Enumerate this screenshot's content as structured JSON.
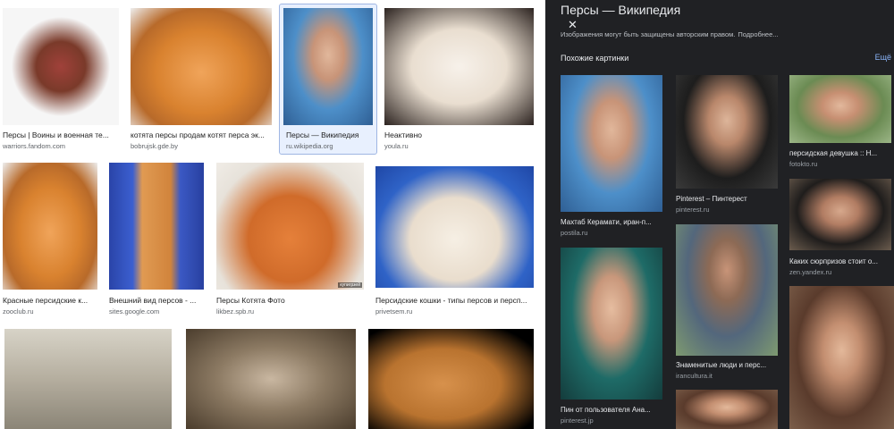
{
  "grid": {
    "row1": [
      {
        "caption": "Персы | Воины и военная те...",
        "source": "warriors.fandom.com"
      },
      {
        "caption": "котята персы продам котят перса эк...",
        "source": "bobrujsk.gde.by"
      },
      {
        "caption": "Персы — Википедия",
        "source": "ru.wikipedia.org"
      },
      {
        "caption": "Неактивно",
        "source": "youla.ru"
      }
    ],
    "row2": [
      {
        "caption": "Красные персидские к...",
        "source": "zooclub.ru"
      },
      {
        "caption": "Внешний вид персов - ...",
        "source": "sites.google.com"
      },
      {
        "caption": "Персы Котята Фото",
        "source": "likbez.spb.ru",
        "watermark": "купигрзей"
      },
      {
        "caption": "Персидские кошки - типы персов и персп...",
        "source": "privetsem.ru"
      }
    ]
  },
  "panel": {
    "title": "Персы — Википедия",
    "close_glyph": "✕",
    "copyright": "Изображения могут быть защищены авторским правом.",
    "more": "Подробнее...",
    "related_header": "Похожие картинки",
    "see_all": "Ещё",
    "col1": [
      {
        "caption": "Махтаб Керамати, иран-п...",
        "source": "postila.ru"
      },
      {
        "caption": "Пин от пользователя Ана...",
        "source": "pinterest.jp"
      }
    ],
    "col2": [
      {
        "caption": "Pinterest – Пинтерест",
        "source": "pinterest.ru"
      },
      {
        "caption": "Знаменитые люди и перс...",
        "source": "irancultura.it"
      }
    ],
    "col3": [
      {
        "caption": "персидская девушка :: Н...",
        "source": "fotokto.ru"
      },
      {
        "caption": "Каких сюрпризов стоит о...",
        "source": "zen.yandex.ru"
      }
    ]
  }
}
